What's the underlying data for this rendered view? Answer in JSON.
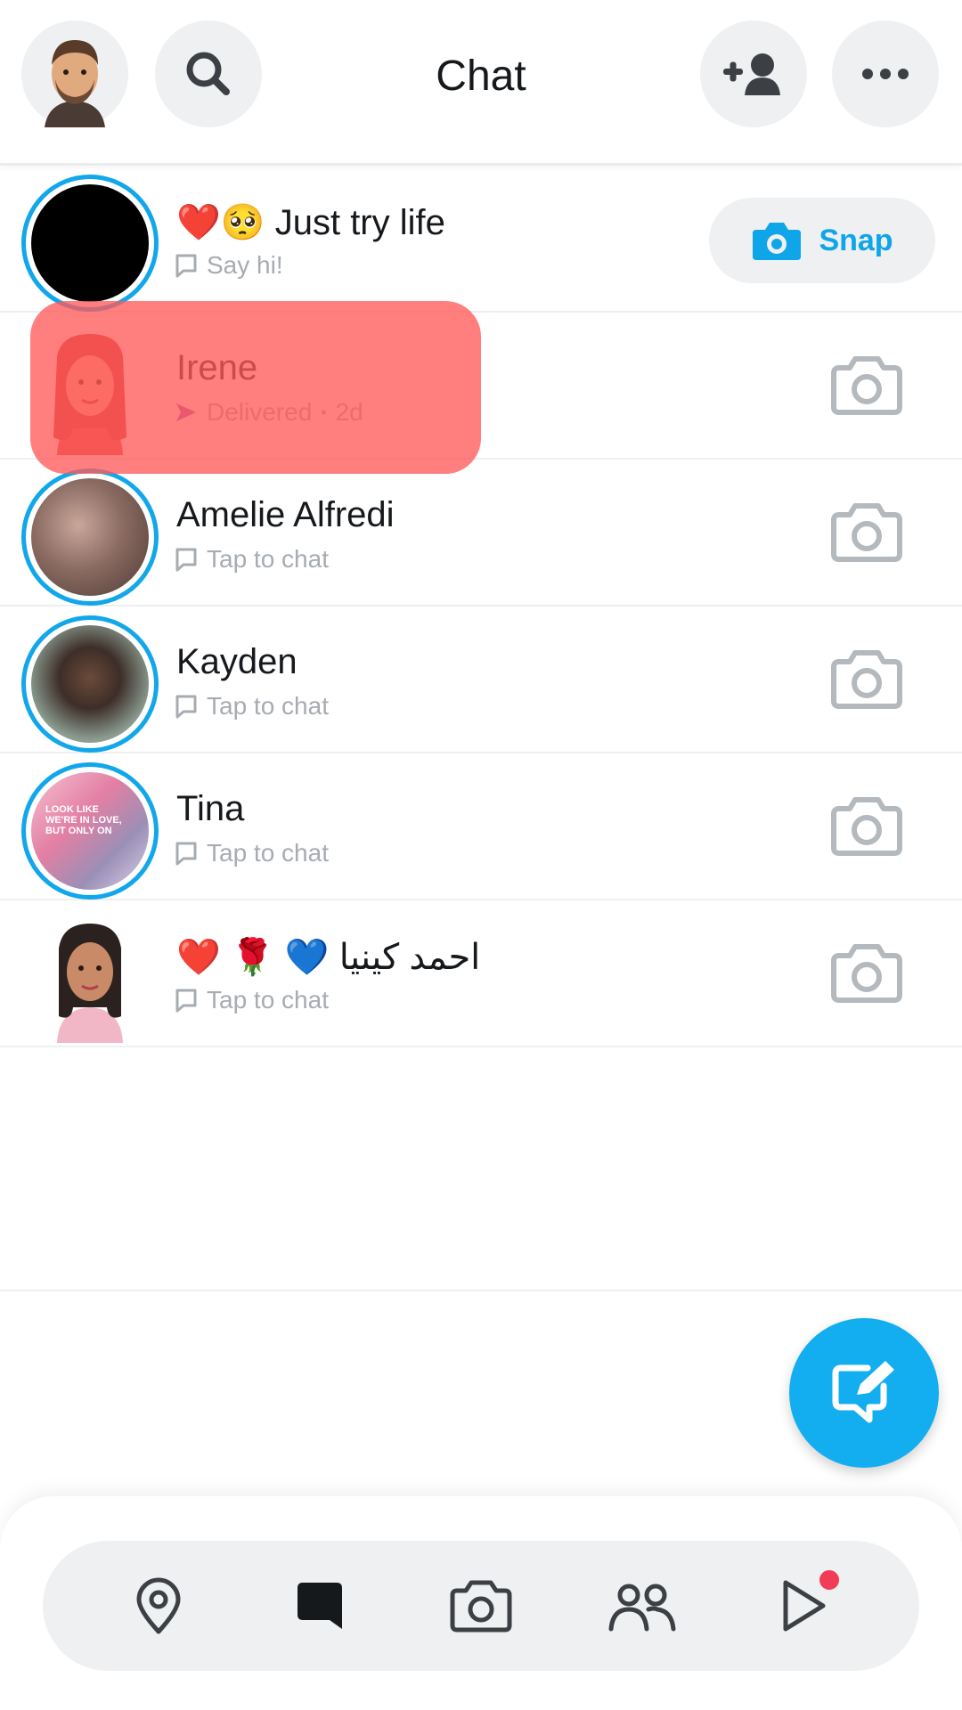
{
  "header": {
    "title": "Chat"
  },
  "chats": [
    {
      "name": "❤️🥺 Just try life",
      "status": "Say hi!",
      "action_label": "Snap"
    },
    {
      "name": "Irene",
      "status": "Delivered",
      "time": "2d"
    },
    {
      "name": "Amelie Alfredi",
      "status": "Tap to chat"
    },
    {
      "name": "Kayden",
      "status": "Tap to chat"
    },
    {
      "name": "Tina",
      "status": "Tap to chat",
      "avatar_text": "LOOK LIKE WE'RE IN LOVE, BUT ONLY ON"
    },
    {
      "name": "❤️ 🌹 💙 احمد كينيا",
      "status": "Tap to chat"
    }
  ],
  "icons": {
    "search": "search-icon",
    "add_friend": "add-friend-icon",
    "more": "more-icon",
    "camera": "camera-icon",
    "compose": "new-chat-icon",
    "nav": [
      "map-pin-icon",
      "chat-bubble-icon",
      "camera-icon",
      "friends-icon",
      "play-icon"
    ]
  },
  "colors": {
    "accent": "#12aef0",
    "ring": "#11a7ea",
    "highlight": "#ff5a5a",
    "badge": "#f23c57"
  }
}
